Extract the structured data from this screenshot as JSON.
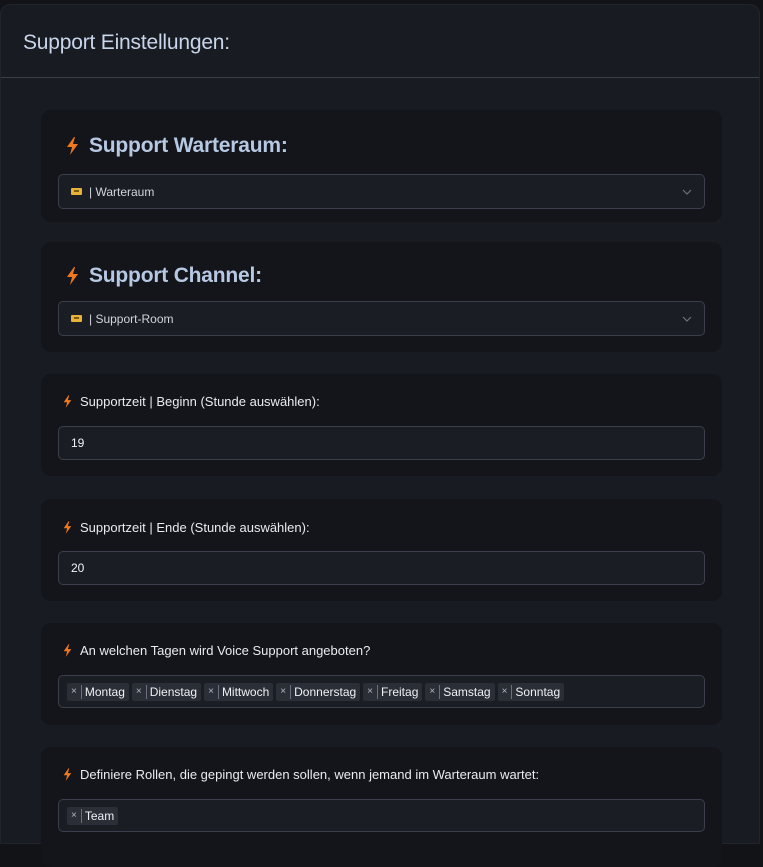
{
  "panel": {
    "title": "Support Einstellungen:"
  },
  "waiting_room": {
    "title": "Support Warteraum:",
    "selected": "| Warteraum"
  },
  "support_channel": {
    "title": "Support Channel:",
    "selected": "| Support-Room"
  },
  "start_time": {
    "label": "Supportzeit | Beginn (Stunde auswählen):",
    "value": "19"
  },
  "end_time": {
    "label": "Supportzeit | Ende (Stunde auswählen):",
    "value": "20"
  },
  "days": {
    "label": "An welchen Tagen wird Voice Support angeboten?",
    "remove_glyph": "×",
    "tags": [
      "Montag",
      "Dienstag",
      "Mittwoch",
      "Donnerstag",
      "Freitag",
      "Samstag",
      "Sonntag"
    ]
  },
  "roles": {
    "label": "Definiere Rollen, die gepingt werden sollen, wenn jemand im Warteraum wartet:",
    "tags": [
      "Team"
    ]
  },
  "colors": {
    "accent_bolt": "#f0781e",
    "heading_blue": "#b7c8e3",
    "card_bg": "#13151b",
    "panel_bg": "#181b22"
  },
  "icons": {
    "bolt": "lightning-icon",
    "channel": "voice-channel-icon",
    "chevron": "chevron-down-icon",
    "remove": "remove-tag-icon"
  }
}
